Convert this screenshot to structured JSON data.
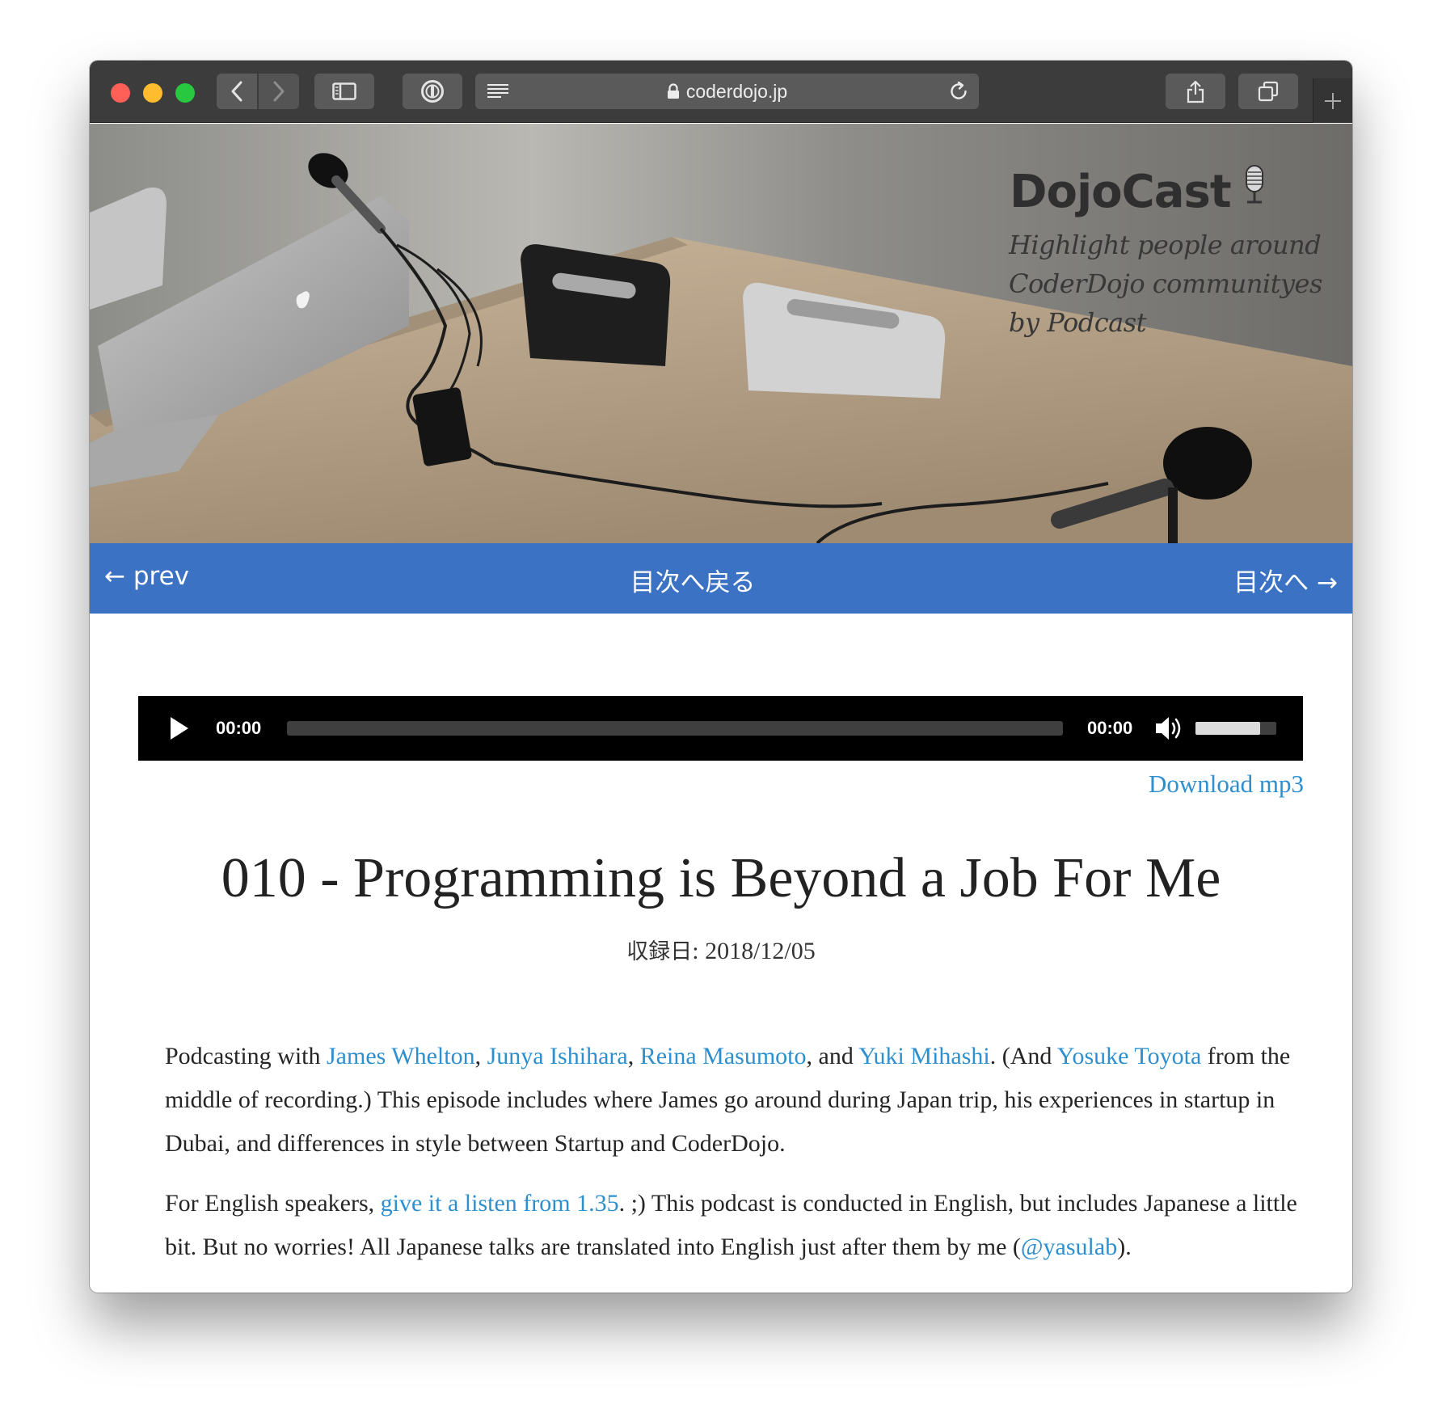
{
  "browser": {
    "url": "coderdojo.jp",
    "icons": {
      "back": "chevron-left-icon",
      "forward": "chevron-right-icon",
      "sidebar": "sidebar-icon",
      "password": "password-manager-icon",
      "reader": "reader-view-icon",
      "lock": "lock-icon",
      "reload": "reload-icon",
      "share": "share-icon",
      "tabs": "tab-overview-icon",
      "new_tab": "plus-icon"
    }
  },
  "hero": {
    "title": "DojoCast",
    "tagline_lines": [
      "Highlight people around",
      "CoderDojo communityes",
      "by Podcast"
    ]
  },
  "nav": {
    "prev": "← prev",
    "toc": "目次へ戻る",
    "next": "目次へ →"
  },
  "player": {
    "current_time": "00:00",
    "total_time": "00:00",
    "progress": 0,
    "volume": 0.8
  },
  "download": {
    "label": "Download mp3"
  },
  "episode": {
    "title": "010 - Programming is Beyond a Job For Me",
    "date_label": "収録日",
    "date_value": ": 2018/12/05"
  },
  "body": {
    "p1": {
      "t0": "Podcasting with ",
      "link1": "James Whelton",
      "t1": ", ",
      "link2": "Junya Ishihara",
      "t2": ", ",
      "link3": "Reina Masumoto",
      "t3": ", and ",
      "link4": "Yuki Mihashi",
      "t4": ". (And ",
      "link5": "Yosuke Toyota",
      "t5": " from the middle of recording.) This episode includes where James go around during Japan trip, his experiences in startup in Dubai, and differences in style between Startup and CoderDojo."
    },
    "p2": {
      "t0": "For English speakers, ",
      "link1": "give it a listen from 1.35",
      "t1": ". ;) This podcast is conducted in English, but includes Japanese a little bit. But no worries! All Japanese talks are translated into English just after them by me (",
      "link2": "@yasulab",
      "t2": ")."
    }
  },
  "colors": {
    "nav_bar": "#3b72c4",
    "link": "#2d8fce",
    "player_bg": "#000000",
    "toolbar": "#3c3c3c"
  }
}
